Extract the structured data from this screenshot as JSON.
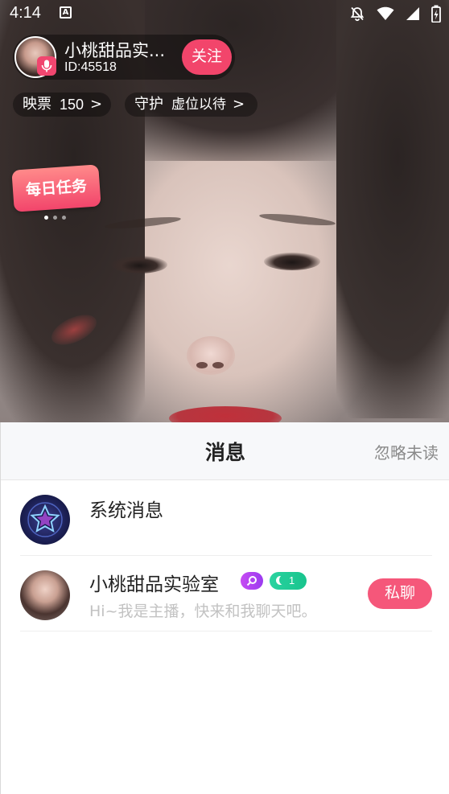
{
  "status_bar": {
    "time": "4:14",
    "left_icon": "A",
    "icons": [
      "mute-bell-icon",
      "wifi-icon",
      "signal-icon",
      "battery-charging-icon"
    ]
  },
  "host": {
    "name": "小桃甜品实验室",
    "name_display": "小桃甜品实...",
    "id_text": "ID:45518",
    "follow_label": "关注"
  },
  "pills": {
    "ticket_label": "映票",
    "ticket_value": "150",
    "guard_label": "守护",
    "guard_value": "虚位以待",
    "chevron": ">"
  },
  "daily_task": {
    "label": "每日任务",
    "carousel_dots": 3,
    "active_dot": 0
  },
  "messages": {
    "title": "消息",
    "ignore_unread": "忽略未读",
    "items": [
      {
        "name": "系统消息",
        "preview": ""
      },
      {
        "name": "小桃甜品实验室",
        "preview": "Hi~我是主播，快来和我聊天吧。",
        "level_badge": "1",
        "action_label": "私聊"
      }
    ]
  },
  "colors": {
    "accent_pink": "#f2456b",
    "chat_button": "#f5577a",
    "badge_purple": "#c64bf2",
    "badge_green": "#22cc98"
  }
}
